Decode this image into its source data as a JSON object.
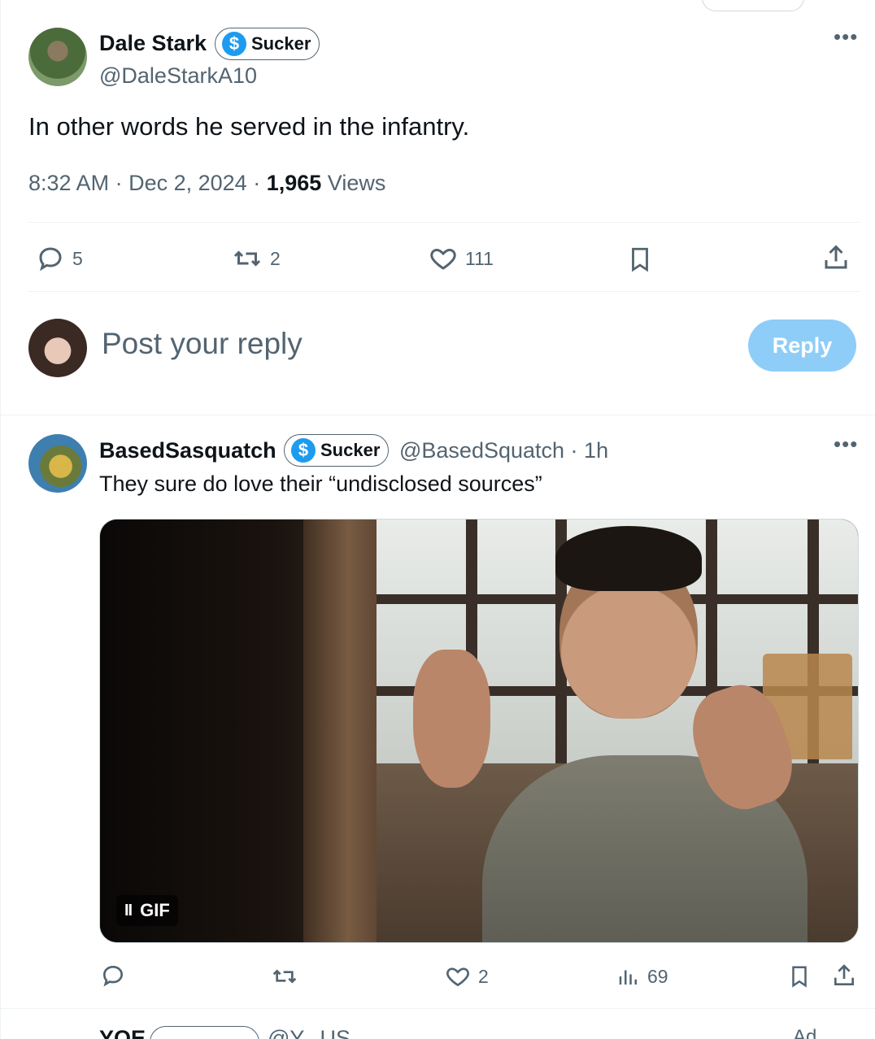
{
  "main_tweet": {
    "author_name": "Dale Stark",
    "badge_label": "Sucker",
    "badge_icon": "dollar-icon",
    "handle": "@DaleStarkA10",
    "text": "In other words he served in the infantry.",
    "time": "8:32 AM",
    "date": "Dec 2, 2024",
    "views_count": "1,965",
    "views_label": "Views",
    "replies": "5",
    "reposts": "2",
    "likes": "111"
  },
  "reply_box": {
    "placeholder": "Post your reply",
    "button_label": "Reply"
  },
  "reply_tweet": {
    "author_name": "BasedSasquatch",
    "badge_label": "Sucker",
    "handle": "@BasedSquatch",
    "age": "1h",
    "text": "They sure do love their “undisclosed sources”",
    "media_type_label": "GIF",
    "pause_label": "II",
    "likes": "2",
    "views": "69"
  },
  "next_tweet": {
    "author_name_partial": "YOE",
    "handle_partial": "@Y...US",
    "ad_label": "Ad"
  },
  "colors": {
    "accent": "#1d9bf0",
    "reply_button_disabled": "#8ecdf8",
    "secondary_text": "#536471",
    "primary_text": "#0f1419"
  }
}
